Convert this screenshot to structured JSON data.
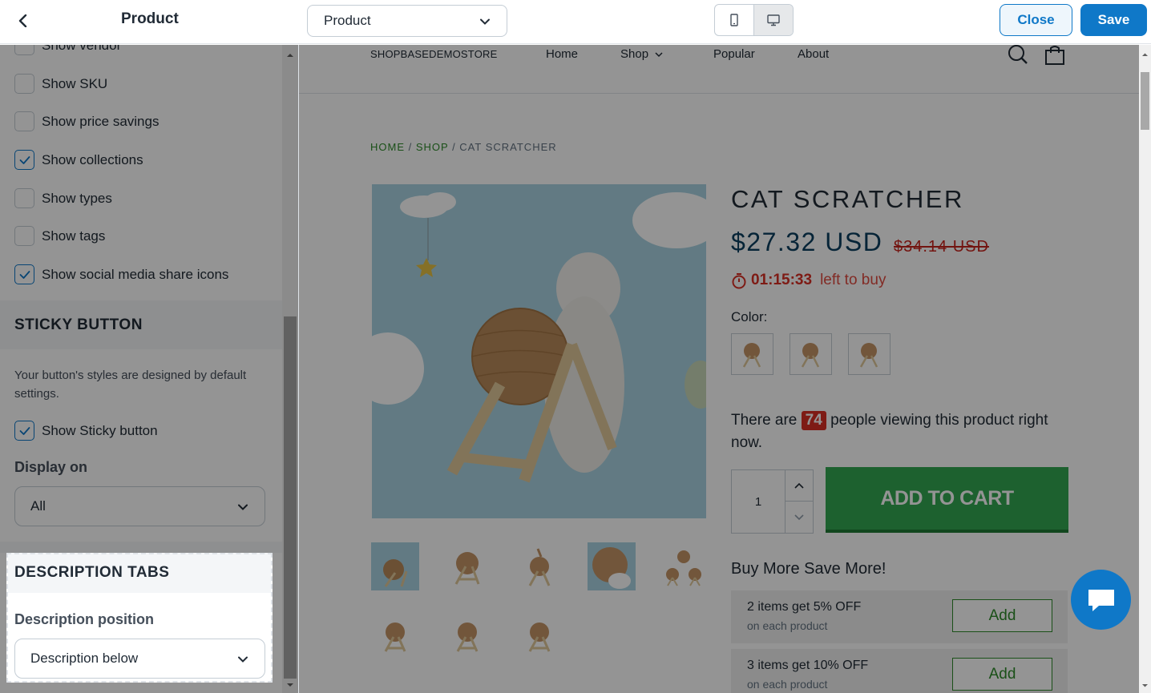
{
  "topbar": {
    "title": "Product",
    "page_select_value": "Product",
    "close_label": "Close",
    "save_label": "Save"
  },
  "sidebar": {
    "checkboxes": [
      {
        "label": "Show vendor",
        "checked": false
      },
      {
        "label": "Show SKU",
        "checked": false
      },
      {
        "label": "Show price savings",
        "checked": false
      },
      {
        "label": "Show collections",
        "checked": true
      },
      {
        "label": "Show types",
        "checked": false
      },
      {
        "label": "Show tags",
        "checked": false
      },
      {
        "label": "Show social media share icons",
        "checked": true
      }
    ],
    "sticky": {
      "heading": "STICKY BUTTON",
      "helper": "Your button's styles are designed by default settings.",
      "checkbox_label": "Show Sticky button",
      "checkbox_checked": true,
      "display_label": "Display on",
      "display_value": "All"
    },
    "description": {
      "heading": "DESCRIPTION TABS",
      "position_label": "Description position",
      "position_value": "Description below"
    }
  },
  "preview": {
    "store_name": "SHOPBASEDEMOSTORE",
    "nav": [
      "Home",
      "Shop",
      "Popular",
      "About"
    ],
    "breadcrumb": {
      "home": "HOME",
      "sep1": " / ",
      "shop": "SHOP",
      "sep2": " / ",
      "current": "CAT SCRATCHER"
    },
    "product": {
      "title": "CAT SCRATCHER",
      "price": "$27.32 USD",
      "compare_price": "$34.14 USD",
      "timer": "01:15:33",
      "timer_suffix": "left to buy",
      "color_label": "Color:",
      "viewing_before": "There are ",
      "viewing_count": "74",
      "viewing_after": " people viewing this product right now.",
      "quantity": "1",
      "add_to_cart": "ADD TO CART",
      "bundle_heading": "Buy More Save More!",
      "offers": [
        {
          "title": "2 items get 5% OFF",
          "sub": "on each product",
          "button": "Add"
        },
        {
          "title": "3 items get 10% OFF",
          "sub": "on each product",
          "button": "Add"
        }
      ]
    }
  },
  "colors": {
    "accent": "#0f78c8",
    "green": "#32a852",
    "price": "#0b3e5f",
    "sale_red": "#d93025"
  }
}
